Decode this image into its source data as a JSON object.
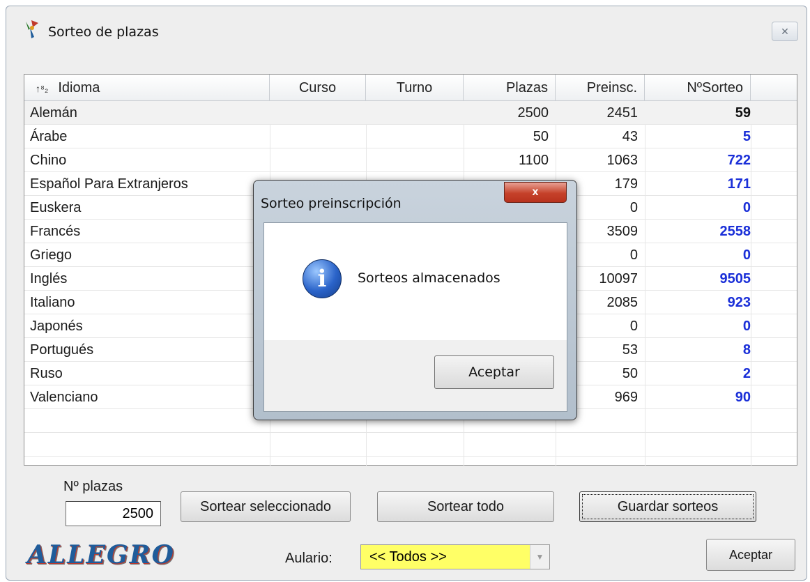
{
  "window": {
    "title": "Sorteo de plazas",
    "close_glyph": "✕"
  },
  "table": {
    "columns": [
      "Idioma",
      "Curso",
      "Turno",
      "Plazas",
      "Preinsc.",
      "NºSorteo"
    ],
    "sort_glyph": "↑⁸₂",
    "rows": [
      {
        "idioma": "Alemán",
        "plazas": "2500",
        "preinsc": "2451",
        "sorteo": "59"
      },
      {
        "idioma": "Árabe",
        "plazas": "50",
        "preinsc": "43",
        "sorteo": "5"
      },
      {
        "idioma": "Chino",
        "plazas": "1100",
        "preinsc": "1063",
        "sorteo": "722"
      },
      {
        "idioma": "Español Para Extranjeros",
        "plazas": "",
        "preinsc": "179",
        "sorteo": "171"
      },
      {
        "idioma": "Euskera",
        "plazas": "",
        "preinsc": "0",
        "sorteo": "0"
      },
      {
        "idioma": "Francés",
        "plazas": "",
        "preinsc": "3509",
        "sorteo": "2558"
      },
      {
        "idioma": "Griego",
        "plazas": "",
        "preinsc": "0",
        "sorteo": "0"
      },
      {
        "idioma": "Inglés",
        "plazas": "",
        "preinsc": "10097",
        "sorteo": "9505"
      },
      {
        "idioma": "Italiano",
        "plazas": "",
        "preinsc": "2085",
        "sorteo": "923"
      },
      {
        "idioma": "Japonés",
        "plazas": "",
        "preinsc": "0",
        "sorteo": "0"
      },
      {
        "idioma": "Portugués",
        "plazas": "",
        "preinsc": "53",
        "sorteo": "8"
      },
      {
        "idioma": "Ruso",
        "plazas": "",
        "preinsc": "50",
        "sorteo": "2"
      },
      {
        "idioma": "Valenciano",
        "plazas": "",
        "preinsc": "969",
        "sorteo": "90"
      }
    ]
  },
  "controls": {
    "plazas_label": "Nº plazas",
    "plazas_value": "2500",
    "sortear_seleccionado": "Sortear seleccionado",
    "sortear_todo": "Sortear todo",
    "guardar_sorteos": "Guardar sorteos",
    "aceptar": "Aceptar",
    "logo_text": "ALLEGRO",
    "aulario_label": "Aulario:",
    "aulario_value": "<< Todos >>"
  },
  "dialog": {
    "title": "Sorteo preinscripción",
    "close_glyph": "x",
    "message": "Sorteos almacenados",
    "button": "Aceptar",
    "icon_glyph": "i"
  },
  "colors": {
    "sorteo_text": "#1a2fd8",
    "aulario_bg": "#ffff66"
  }
}
